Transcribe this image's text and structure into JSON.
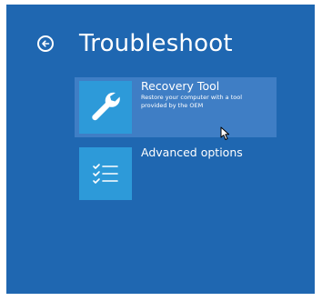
{
  "page": {
    "title": "Troubleshoot",
    "back_icon": "back-arrow-circle-icon"
  },
  "options": [
    {
      "title": "Recovery Tool",
      "description": "Restore your computer with a tool provided by the OEM",
      "icon": "wrench-icon",
      "selected": true
    },
    {
      "title": "Advanced options",
      "description": "",
      "icon": "checklist-icon",
      "selected": false
    }
  ],
  "colors": {
    "background": "#1f67b1",
    "tile": "#2d9ad9",
    "selected_highlight": "#3f7ec5",
    "text": "#ffffff"
  }
}
